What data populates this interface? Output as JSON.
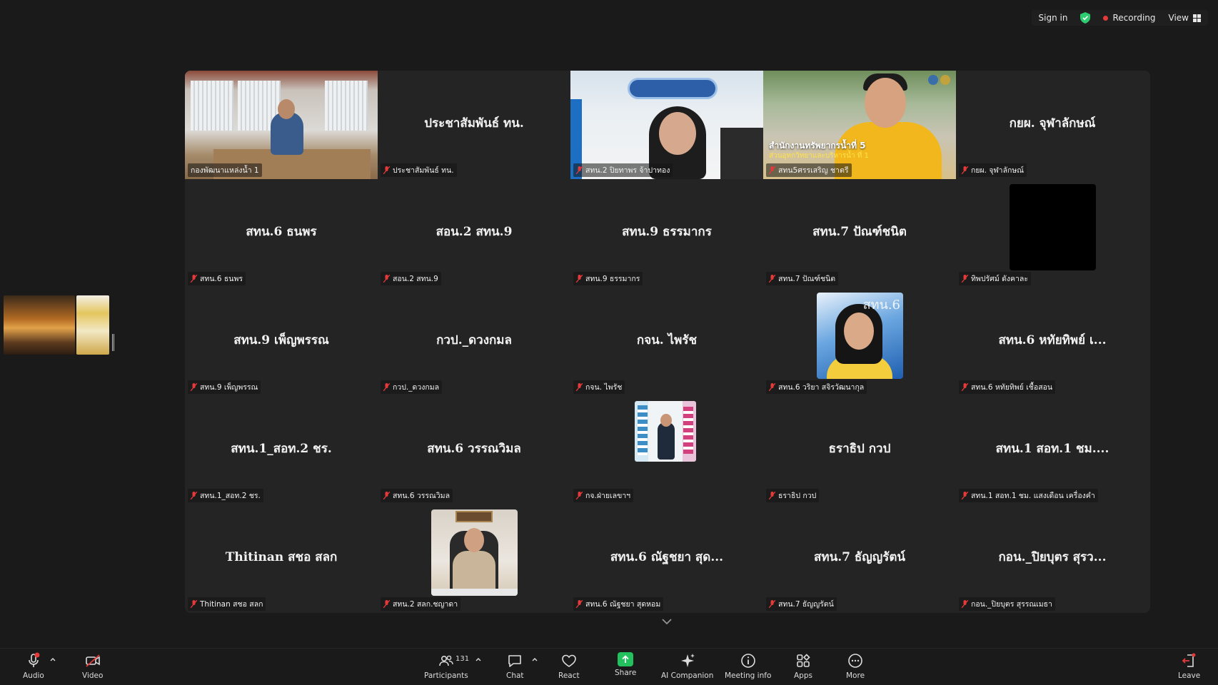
{
  "topbar": {
    "sign_in": "Sign in",
    "recording": "Recording",
    "view": "View"
  },
  "colors": {
    "active_border": "#2fd680",
    "recording_dot": "#e5393a",
    "share_green": "#22c15e",
    "shield_green": "#2ecc71"
  },
  "tiles": [
    {
      "name": "",
      "label": "กองพัฒนาแหล่งน้ำ 1"
    },
    {
      "name": "ประชาสัมพันธ์ ทน.",
      "label": "ประชาสัมพันธ์ ทน."
    },
    {
      "name": "",
      "label": "สทน.2 ปิยทาพร จ้าปาทอง"
    },
    {
      "name": "",
      "label": "สทน5ศรรเสริญ ชาตรี",
      "caption1": "สำนักงานทรัพยากรน้ำที่ 5",
      "caption2": "ส่วนอุทกวิทยาและบริหารน้ำ ที่ 1"
    },
    {
      "name": "กยผ. จุฬาลักษณ์",
      "label": "กยผ. จุฬาลักษณ์"
    },
    {
      "name": "สทน.6 ธนพร",
      "label": "สทน.6 ธนพร"
    },
    {
      "name": "สอน.2 สทน.9",
      "label": "สอน.2 สทน.9"
    },
    {
      "name": "สทน.9 ธรรมากร",
      "label": "สทน.9 ธรรมากร"
    },
    {
      "name": "สทน.7 ปัณฑ์ชนิต",
      "label": "สทน.7 ปัณฑ์ชนิต"
    },
    {
      "name": "",
      "label": "ทิพปรัศม์ ดังคาละ"
    },
    {
      "name": "สทน.9 เพ็ญพรรณ",
      "label": "สทน.9 เพ็ญพรรณ"
    },
    {
      "name": "กวป._ดวงกมล",
      "label": "กวป._ดวงกมล"
    },
    {
      "name": "กจน. ไพรัช",
      "label": "กจน. ไพรัช"
    },
    {
      "name": "",
      "label": "สทน.6 วริยา สจิรวัฒนากุล",
      "image_text": "สทน.6"
    },
    {
      "name": "สทน.6 หทัยทิพย์ เ...",
      "label": "สทน.6 หทัยทิพย์ เชื้อสอน"
    },
    {
      "name": "สทน.1_สอท.2 ชร.",
      "label": "สทน.1_สอท.2 ชร."
    },
    {
      "name": "สทน.6 วรรณวิมล",
      "label": "สทน.6 วรรณวิมล"
    },
    {
      "name": "",
      "label": "กจ.ฝ่ายเลขาฯ"
    },
    {
      "name": "ธราธิป กวป",
      "label": "ธราธิป กวป"
    },
    {
      "name": "สทน.1 สอท.1 ชม....",
      "label": "สทน.1 สอท.1 ชม. แสงเดือน เครื่องคำ"
    },
    {
      "name": "Thitinan สชอ สลก",
      "label": "Thitinan สชอ สลก"
    },
    {
      "name": "",
      "label": "สทน.2 สลก.ชญาดา"
    },
    {
      "name": "สทน.6 ณัฐชยา สุด...",
      "label": "สทน.6 ณัฐชยา สุดหอม"
    },
    {
      "name": "สทน.7 ธัญญรัตน์",
      "label": "สทน.7 ธัญญรัตน์"
    },
    {
      "name": "กอน._ปิยบุตร สุรว...",
      "label": "กอน._ปิยบุตร สุรรณเมธา"
    }
  ],
  "toolbar": {
    "audio": "Audio",
    "video": "Video",
    "participants": "Participants",
    "participant_count": "131",
    "chat": "Chat",
    "react": "React",
    "share": "Share",
    "ai_companion": "AI Companion",
    "meeting_info": "Meeting info",
    "apps": "Apps",
    "more": "More",
    "leave": "Leave"
  }
}
